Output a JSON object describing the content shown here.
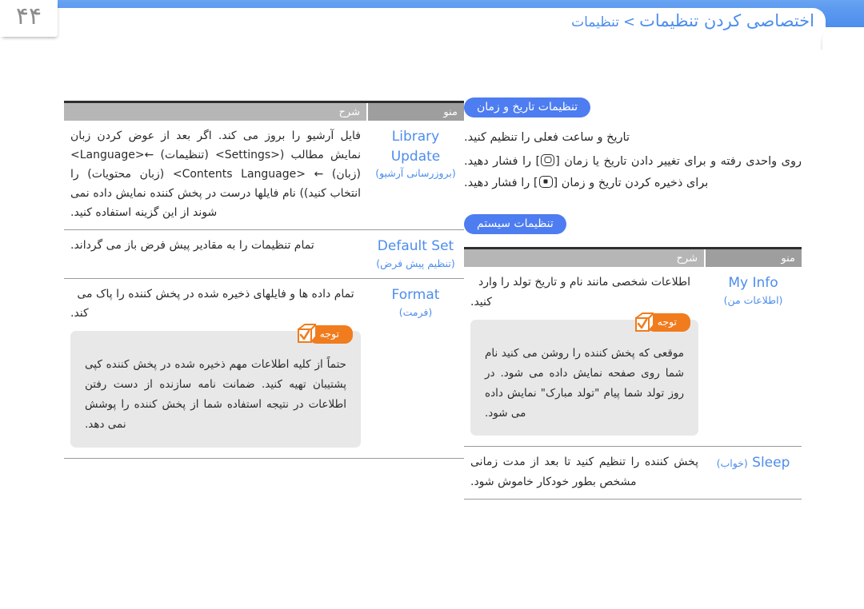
{
  "page": {
    "number": "۴۴",
    "breadcrumb": {
      "current": "اختصاصی کردن تنظیمات",
      "separator": ">",
      "parent": "تنظیمات"
    },
    "accent_blue": "#4d8ded",
    "pill_blue": "#4d7df0",
    "note_orange": "#f07c1e",
    "table_header_gray": "#b6b6b6"
  },
  "left_column": {
    "table": {
      "headers": {
        "menu": "منو",
        "description": "شرح"
      },
      "rows": [
        {
          "menu_en": "Library Update",
          "menu_fa": "(بروزرسانی آرشیو)",
          "description": "فایل آرشیو را بروز می کند. اگر بعد از عوض کردن زبان نمایش مطالب (<Settings> (تنظیمات) ←<Language> (زبان) ← <Contents Language> (زبان محتویات) را انتخاب کنید)) نام فایلها درست در پخش کننده نمایش داده نمی شوند از این گزینه استفاده کنید."
        },
        {
          "menu_en": "Default Set",
          "menu_fa": "(تنظیم پیش فرض)",
          "description": "تمام تنظیمات را به مقادیر پیش فرض باز می گرداند."
        },
        {
          "menu_en": "Format",
          "menu_fa": "(فرمت)",
          "description": "تمام داده ها و فایلهای ذخیره شده در پخش کننده را پاک می کند."
        }
      ]
    },
    "note": {
      "label": "توجه",
      "icon": "note-check-icon",
      "text": "حتماً از کلیه اطلاعات مهم ذخیره شده در پخش کننده کپی پشتیبان تهیه کنید. ضمانت نامه سازنده از دست رفتن اطلاعات در نتیجه استفاده شما از پخش کننده را پوشش نمی دهد."
    }
  },
  "right_column": {
    "datetime_section": {
      "pill": "تنظیمات تاریخ و زمان",
      "line1": "تاریخ و ساعت فعلی را تنظیم کنید.",
      "line2_a": "روی واحدی رفته و برای تغییر دادن تاریخ یا زمان [",
      "line2_b": "] را فشار دهید. برای ذخیره کردن تاریخ و زمان [",
      "line2_c": "] را فشار دهید."
    },
    "system_section": {
      "pill": "تنظیمات سیستم",
      "table": {
        "headers": {
          "menu": "منو",
          "description": "شرح"
        },
        "rows": [
          {
            "menu_en": "My Info",
            "menu_fa": "(اطلاعات من)",
            "description": "اطلاعات شخصی مانند نام و تاریخ تولد را وارد کنید."
          },
          {
            "menu_en": "Sleep",
            "menu_fa": "(خواب)",
            "description": "پخش کننده را تنظیم کنید تا بعد از مدت زمانی مشخص بطور خودکار خاموش شود."
          }
        ]
      },
      "note": {
        "label": "توجه",
        "icon": "note-check-icon",
        "text": "موقعی که پخش کننده را روشن می کنید نام شما روی صفحه نمایش داده می شود. در روز تولد شما پیام \"تولد مبارک\" نمایش داده می شود."
      }
    }
  }
}
